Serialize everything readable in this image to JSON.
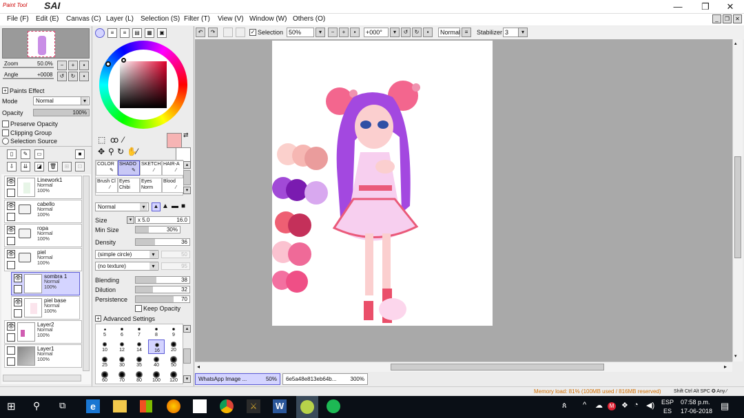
{
  "app": {
    "logo_small": "Paint Tool",
    "logo_big": "SAI"
  },
  "window_controls": {
    "minimize": "—",
    "maximize": "❐",
    "close": "✕"
  },
  "menu": [
    "File (F)",
    "Edit (E)",
    "Canvas (C)",
    "Layer (L)",
    "Selection (S)",
    "Filter (T)",
    "View (V)",
    "Window (W)",
    "Others (O)"
  ],
  "navigator": {
    "zoom_label": "Zoom",
    "zoom_value": "50.0%",
    "angle_label": "Angle",
    "angle_value": "+0008"
  },
  "paints_effect": {
    "title": "Paints Effect",
    "mode_label": "Mode",
    "mode_value": "Normal",
    "opacity_label": "Opacity",
    "opacity_value": "100%",
    "opacity_fraction": 1.0,
    "preserve_opacity": "Preserve Opacity",
    "clipping_group": "Clipping Group",
    "selection_source": "Selection Source"
  },
  "layers": [
    {
      "name": "Linework1",
      "mode": "Normal",
      "opacity": "100%",
      "visible": true,
      "type": "layer"
    },
    {
      "name": "cabello",
      "mode": "Normal",
      "opacity": "100%",
      "visible": true,
      "type": "folder"
    },
    {
      "name": "ropa",
      "mode": "Normal",
      "opacity": "100%",
      "visible": true,
      "type": "folder"
    },
    {
      "name": "piel",
      "mode": "Normal",
      "opacity": "100%",
      "visible": true,
      "type": "folder"
    },
    {
      "name": "sombra 1",
      "mode": "Normal",
      "opacity": "100%",
      "visible": true,
      "type": "layer",
      "selected": true
    },
    {
      "name": "piel base",
      "mode": "Normal",
      "opacity": "100%",
      "visible": false,
      "type": "layer"
    },
    {
      "name": "Layer2",
      "mode": "Normal",
      "opacity": "100%",
      "visible": true,
      "type": "layer"
    },
    {
      "name": "Layer1",
      "mode": "Normal",
      "opacity": "100%",
      "visible": false,
      "type": "layer"
    }
  ],
  "colors": {
    "primary": "#f6b4b4",
    "secondary": "#ffffff",
    "accent": "#5a5ad6"
  },
  "brushes": {
    "row1": [
      "COLOR",
      "SHADO",
      "SKETCH",
      "HAIR-A"
    ],
    "row2": [
      "Brush Cl",
      "Eyes Chibi",
      "Eyes Norm",
      "Blood"
    ],
    "selected": "SHADO"
  },
  "tool_settings": {
    "blend_mode": "Normal",
    "size_label": "Size",
    "size_mult": "x 5.0",
    "size_value": "16.0",
    "min_size_label": "Min Size",
    "min_size_value": "30%",
    "min_size_fraction": 0.3,
    "density_label": "Density",
    "density_value": "36",
    "density_fraction": 0.36,
    "shape": "(simple circle)",
    "shape_value": "50",
    "texture": "(no texture)",
    "texture_value": "95",
    "blending_label": "Blending",
    "blending_value": "38",
    "blending_fraction": 0.38,
    "dilution_label": "Dilution",
    "dilution_value": "32",
    "dilution_fraction": 0.32,
    "persistence_label": "Persistence",
    "persistence_value": "70",
    "persistence_fraction": 0.7,
    "keep_opacity": "Keep Opacity",
    "advanced": "Advanced Settings"
  },
  "brush_sizes": [
    "5",
    "6",
    "7",
    "8",
    "9",
    "10",
    "12",
    "14",
    "16",
    "20",
    "25",
    "30",
    "35",
    "40",
    "50",
    "60",
    "70",
    "80",
    "100",
    "120"
  ],
  "selected_brush_size": "16",
  "toolbar": {
    "selection_label": "Selection",
    "zoom_value": "50%",
    "angle_value": "+000°",
    "blend_value": "Normal",
    "stabilizer_label": "Stabilizer",
    "stabilizer_value": "3"
  },
  "tabs": [
    {
      "name": "WhatsApp Image ...",
      "zoom": "50%",
      "active": true
    },
    {
      "name": "6e5a48e813eb64b...",
      "zoom": "300%",
      "active": false
    }
  ],
  "status": {
    "memory": "Memory load: 81% (100MB used / 816MB reserved)",
    "keys": "Shift Ctrl Alt SPC ✪ Any ⁄"
  },
  "taskbar": {
    "lang": "ESP",
    "lang2": "ES",
    "time": "07:58 p.m.",
    "date": "17-06-2018"
  }
}
